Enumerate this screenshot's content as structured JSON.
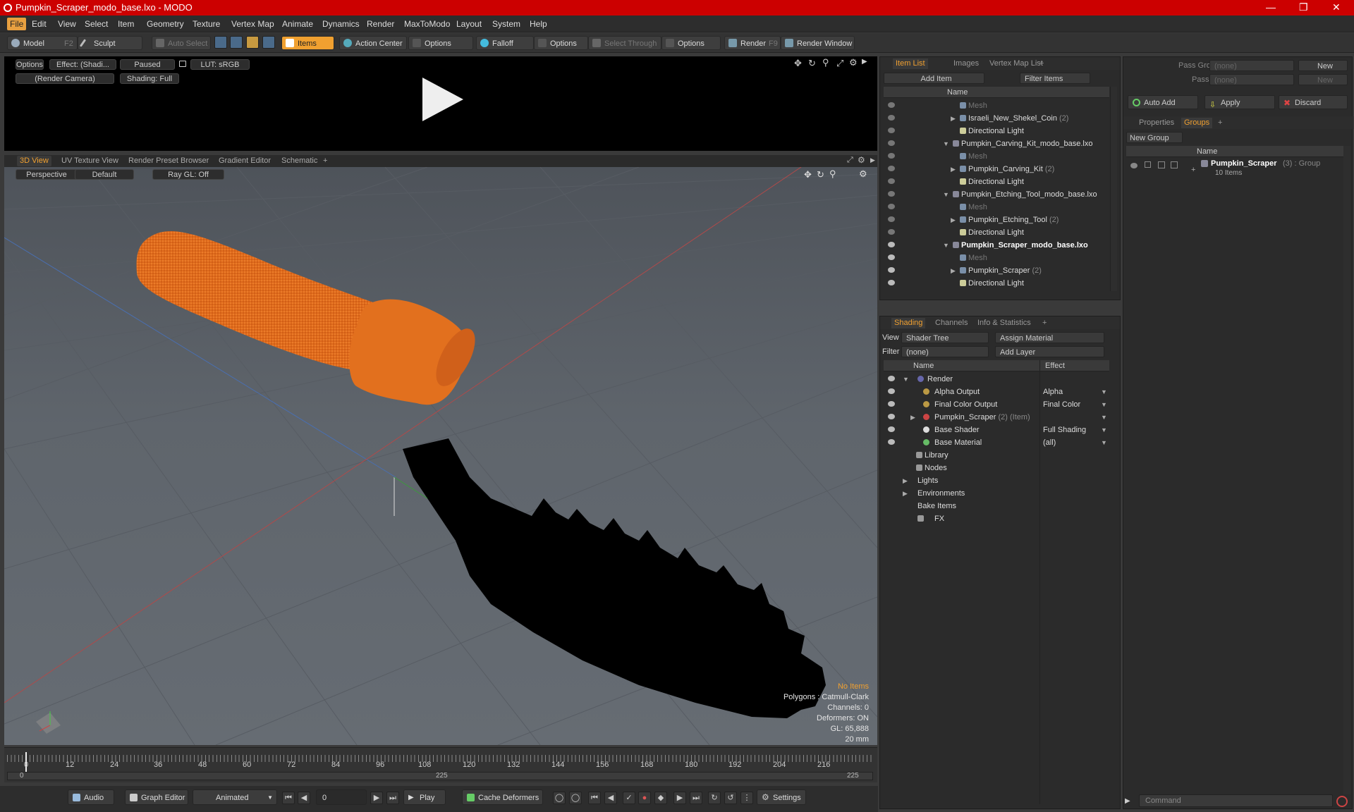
{
  "window": {
    "title": "Pumpkin_Scraper_modo_base.lxo - MODO"
  },
  "menu": [
    "File",
    "Edit",
    "View",
    "Select",
    "Item",
    "Geometry",
    "Texture",
    "Vertex Map",
    "Animate",
    "Dynamics",
    "Render",
    "MaxToModo",
    "Layout",
    "System",
    "Help"
  ],
  "toolbar": {
    "model": "Model",
    "model_key": "F2",
    "sculpt": "Sculpt",
    "auto_select": "Auto Select",
    "items": "Items",
    "action_center": "Action Center",
    "options1": "Options",
    "falloff": "Falloff",
    "options2": "Options",
    "select_through": "Select Through",
    "options3": "Options",
    "render": "Render",
    "render_key": "F9",
    "render_window": "Render Window"
  },
  "preview": {
    "options": "Options",
    "effect": "Effect: (Shadi...",
    "paused": "Paused",
    "lut": "LUT: sRGB",
    "camera": "(Render Camera)",
    "shading": "Shading: Full"
  },
  "view_tabs": [
    "3D View",
    "UV Texture View",
    "Render Preset Browser",
    "Gradient Editor",
    "Schematic",
    "+"
  ],
  "viewport": {
    "perspective": "Perspective",
    "default": "Default",
    "raygl": "Ray GL: Off",
    "info": {
      "no_items": "No Items",
      "polygons": "Polygons : Catmull-Clark",
      "channels": "Channels: 0",
      "deformers": "Deformers: ON",
      "gl": "GL: 65,888",
      "scale": "20 mm"
    }
  },
  "timeline": {
    "ticks": [
      "0",
      "12",
      "24",
      "36",
      "48",
      "60",
      "72",
      "84",
      "96",
      "108",
      "120",
      "132",
      "144",
      "156",
      "168",
      "180",
      "192",
      "204",
      "216"
    ],
    "start": "0",
    "mid": "225",
    "end": "225"
  },
  "bottom": {
    "audio": "Audio",
    "graph_editor": "Graph Editor",
    "animated": "Animated",
    "frame": "0",
    "play": "Play",
    "cache": "Cache Deformers",
    "settings": "Settings"
  },
  "item_list": {
    "tabs": [
      "Item List",
      "Images",
      "Vertex Map List",
      "+"
    ],
    "add_item": "Add Item",
    "filter": "Filter Items",
    "col_name": "Name",
    "rows": [
      {
        "name": "Mesh",
        "count": "",
        "indent": 1,
        "dim": true
      },
      {
        "name": "Israeli_New_Shekel_Coin",
        "count": "(2)",
        "indent": 1
      },
      {
        "name": "Directional Light",
        "count": "",
        "indent": 1
      },
      {
        "name": "Pumpkin_Carving_Kit_modo_base.lxo",
        "count": "",
        "indent": 0
      },
      {
        "name": "Mesh",
        "count": "",
        "indent": 1,
        "dim": true
      },
      {
        "name": "Pumpkin_Carving_Kit",
        "count": "(2)",
        "indent": 1
      },
      {
        "name": "Directional Light",
        "count": "",
        "indent": 1
      },
      {
        "name": "Pumpkin_Etching_Tool_modo_base.lxo",
        "count": "",
        "indent": 0
      },
      {
        "name": "Mesh",
        "count": "",
        "indent": 1,
        "dim": true
      },
      {
        "name": "Pumpkin_Etching_Tool",
        "count": "(2)",
        "indent": 1
      },
      {
        "name": "Directional Light",
        "count": "",
        "indent": 1
      },
      {
        "name": "Pumpkin_Scraper_modo_base.lxo",
        "count": "",
        "indent": 0,
        "bold": true
      },
      {
        "name": "Mesh",
        "count": "",
        "indent": 1,
        "dim": true
      },
      {
        "name": "Pumpkin_Scraper",
        "count": "(2)",
        "indent": 1
      },
      {
        "name": "Directional Light",
        "count": "",
        "indent": 1
      }
    ]
  },
  "shading": {
    "tabs": [
      "Shading",
      "Channels",
      "Info & Statistics",
      "+"
    ],
    "view_label": "View",
    "view_value": "Shader Tree",
    "assign": "Assign Material",
    "filter_label": "Filter",
    "filter_value": "(none)",
    "add_layer": "Add Layer",
    "col_name": "Name",
    "col_effect": "Effect",
    "rows": [
      {
        "name": "Render",
        "effect": "",
        "indent": 0
      },
      {
        "name": "Alpha Output",
        "effect": "Alpha",
        "indent": 1
      },
      {
        "name": "Final Color Output",
        "effect": "Final Color",
        "indent": 1
      },
      {
        "name": "Pumpkin_Scraper",
        "suffix": "(2) (Item)",
        "effect": "",
        "indent": 1
      },
      {
        "name": "Base Shader",
        "effect": "Full Shading",
        "indent": 1
      },
      {
        "name": "Base Material",
        "effect": "(all)",
        "indent": 1
      },
      {
        "name": "Library",
        "effect": "",
        "indent": 0
      },
      {
        "name": "Nodes",
        "effect": "",
        "indent": 0
      },
      {
        "name": "Lights",
        "effect": "",
        "indent": -1
      },
      {
        "name": "Environments",
        "effect": "",
        "indent": -1
      },
      {
        "name": "Bake Items",
        "effect": "",
        "indent": -1
      },
      {
        "name": "FX",
        "effect": "",
        "indent": -1
      }
    ]
  },
  "groups": {
    "pass_groups": "Pass Groups",
    "pass_groups_val": "(none)",
    "new": "New",
    "passes": "Passes",
    "passes_val": "(none)",
    "new2": "New",
    "auto_add": "Auto Add",
    "apply": "Apply",
    "discard": "Discard",
    "tabs": [
      "Properties",
      "Groups",
      "+"
    ],
    "new_group": "New Group",
    "col_name": "Name",
    "group_name": "Pumpkin_Scraper",
    "group_meta": "(3) : Group",
    "group_items": "10 Items"
  },
  "command": {
    "placeholder": "Command"
  },
  "colors": {
    "accent": "#f0a030",
    "title": "#cc0000",
    "handle": "#e06a1c"
  }
}
